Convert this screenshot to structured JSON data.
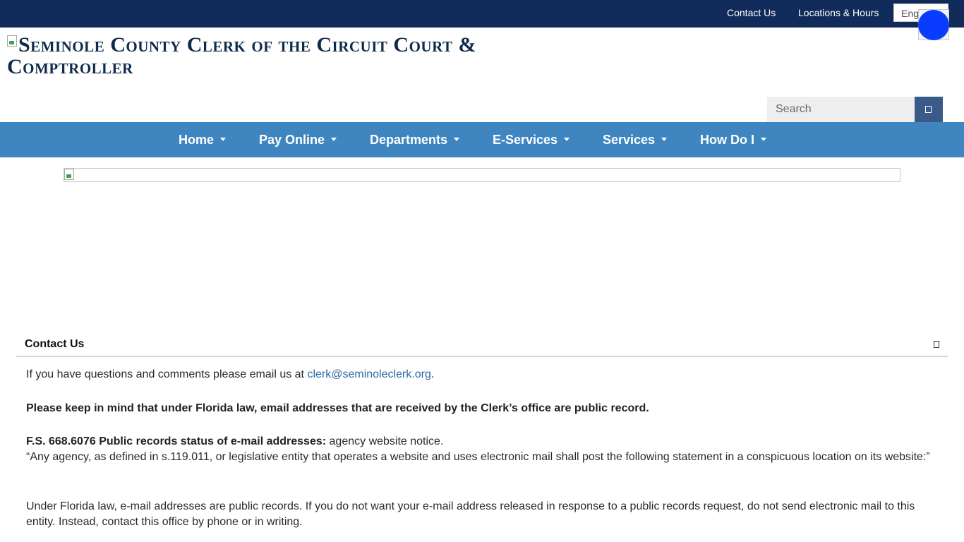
{
  "topbar": {
    "contact_label": "Contact Us",
    "locations_label": "Locations & Hours",
    "language_value": "English"
  },
  "header": {
    "logo_alt_text": "Seminole County Clerk of the Circuit Court & Comptroller"
  },
  "search": {
    "placeholder": "Search"
  },
  "nav": {
    "items": [
      {
        "label": "Home"
      },
      {
        "label": "Pay Online"
      },
      {
        "label": "Departments"
      },
      {
        "label": "E-Services"
      },
      {
        "label": "Services"
      },
      {
        "label": "How Do I"
      }
    ]
  },
  "contact_panel": {
    "title": "Contact Us",
    "intro_text": "If you have questions and comments please email us at ",
    "email": "clerk@seminoleclerk.org",
    "intro_end": ".",
    "notice_bold": "Please keep in mind that under Florida law, email addresses that are received by the Clerk’s office are public record.",
    "statute_bold": "F.S. 668.6076 Public records status of e-mail addresses:",
    "statute_rest": " agency website notice.",
    "statute_quote": "“Any agency, as defined in s.119.011, or legislative entity that operates a website and uses electronic mail shall post the following statement in a conspicuous location on its website:”",
    "statement": "Under Florida law, e-mail addresses are public records. If you do not want your e-mail address released in response to a public records request, do not send electronic mail to this entity. Instead, contact this office by phone or in writing."
  },
  "colors": {
    "topbar": "#102a5a",
    "nav": "#3f86c0",
    "logo_text": "#0f2b4c",
    "link": "#2a6aa6",
    "search_button": "#3a5a8a",
    "a11y_widget": "#0a3cff"
  }
}
